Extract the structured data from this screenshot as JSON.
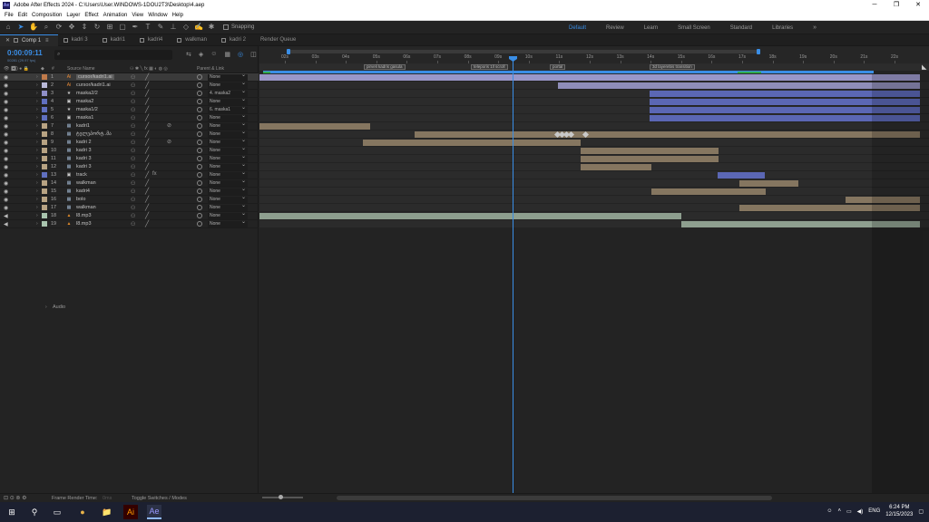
{
  "window": {
    "title": "Adobe After Effects 2024 - C:\\Users\\User.WINDOWS-1DOU2T3\\Desktop\\4.aep",
    "app_icon": "Ae",
    "controls": [
      "─",
      "❐",
      "✕"
    ]
  },
  "menu": [
    "File",
    "Edit",
    "Composition",
    "Layer",
    "Effect",
    "Animation",
    "View",
    "Window",
    "Help"
  ],
  "toolbar": {
    "snapping_label": "Snapping",
    "workspaces": [
      "Default",
      "Review",
      "Learn",
      "Small Screen",
      "Standard",
      "Libraries"
    ],
    "active_workspace": "Default",
    "more": "»"
  },
  "tabs": [
    {
      "label": "Comp 1",
      "active": true
    },
    {
      "label": "kadri 3"
    },
    {
      "label": "kadri1"
    },
    {
      "label": "kadri4"
    },
    {
      "label": "walkman"
    },
    {
      "label": "kadri 2"
    },
    {
      "label": "Render Queue"
    }
  ],
  "timeline": {
    "timecode": "0:00:09:11",
    "fps": "00281 (29.97 fps)",
    "search_placeholder": "",
    "ruler_labels": [
      "02s",
      "03s",
      "04s",
      "05s",
      "06s",
      "07s",
      "08s",
      "09s",
      "10s",
      "11s",
      "12s",
      "13s",
      "14s",
      "15s",
      "16s",
      "17s",
      "18s",
      "19s",
      "20s",
      "21s",
      "22s"
    ],
    "markers": [
      "pirveli kadris gasula",
      "teleporis 1ll scroll",
      "portal",
      "3d layerebis transition"
    ],
    "columns": {
      "hash": "#",
      "source_name": "Source Name",
      "parent": "Parent & Link"
    }
  },
  "layers": [
    {
      "num": "1",
      "name": "cursor/kadri1.ai",
      "type": "ai",
      "parent": "None",
      "selected": true
    },
    {
      "num": "2",
      "name": "cursor/kadri1.ai",
      "type": "ai",
      "parent": "None"
    },
    {
      "num": "3",
      "name": "maska2/2",
      "type": "star",
      "parent": "4. maska2"
    },
    {
      "num": "4",
      "name": "maska2",
      "type": "star-box",
      "parent": "None"
    },
    {
      "num": "5",
      "name": "maska1/2",
      "type": "star",
      "parent": "6. maska1"
    },
    {
      "num": "6",
      "name": "maska1",
      "type": "star-box",
      "parent": "None"
    },
    {
      "num": "7",
      "name": "kadri1",
      "type": "comp",
      "parent": "None"
    },
    {
      "num": "8",
      "name": "ტელეპორტ..მა",
      "type": "comp",
      "parent": "None"
    },
    {
      "num": "9",
      "name": "kadri 2",
      "type": "comp",
      "parent": "None"
    },
    {
      "num": "10",
      "name": "kadri 3",
      "type": "comp",
      "parent": "None"
    },
    {
      "num": "11",
      "name": "kadri 3",
      "type": "comp",
      "parent": "None"
    },
    {
      "num": "12",
      "name": "kadri 3",
      "type": "comp",
      "parent": "None"
    },
    {
      "num": "13",
      "name": "track",
      "type": "star-box",
      "parent": "None"
    },
    {
      "num": "14",
      "name": "walkman",
      "type": "comp",
      "parent": "None"
    },
    {
      "num": "15",
      "name": "kadri4",
      "type": "comp",
      "parent": "None"
    },
    {
      "num": "16",
      "name": "bolo",
      "type": "comp",
      "parent": "None"
    },
    {
      "num": "17",
      "name": "walkman",
      "type": "comp",
      "parent": "None"
    },
    {
      "num": "18",
      "name": "l8.mp3",
      "type": "audio",
      "parent": "None"
    },
    {
      "num": "19",
      "name": "l8.mp3",
      "type": "audio",
      "parent": "None"
    }
  ],
  "audio_group": "Audio",
  "status": {
    "frame_render_label": "Frame Render Time:",
    "frame_render_value": "0ms",
    "toggle_label": "Toggle Switches / Modes"
  },
  "taskbar": {
    "apps": [
      "⊞",
      "⚲",
      "▭",
      "●",
      "📁",
      "Ai",
      "Ae"
    ],
    "tray_lang": "ENG",
    "time": "6:24 PM",
    "date": "12/15/2023"
  },
  "colors": {
    "accent": "#3a8ee6",
    "label_tan": "#8c7b65",
    "label_blue": "#6070c0",
    "label_lavender": "#8f8fc8",
    "label_audio": "#8aa38f"
  }
}
